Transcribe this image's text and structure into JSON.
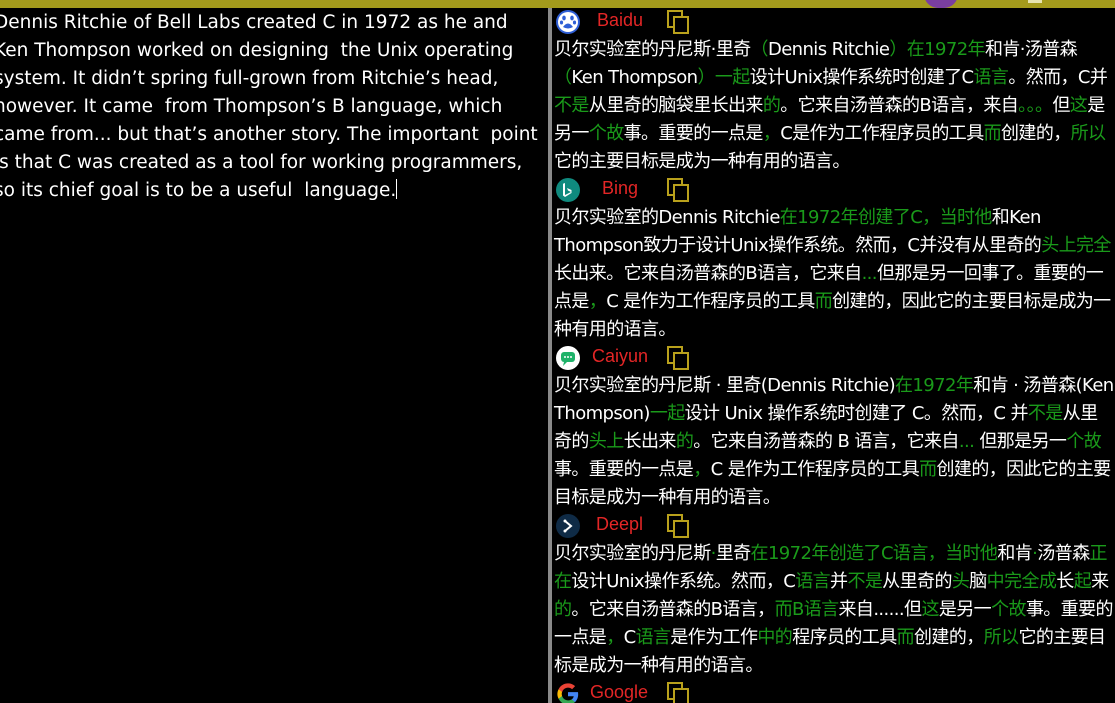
{
  "source": {
    "text": "Dennis Ritchie of Bell Labs created C in 1972 as he and Ken Thompson worked on designing  the Unix operating system. It didn’t spring full-grown from Ritchie’s head, however. It came  from Thompson’s B language, which came from... but that’s another story. The important  point is that C was created as a tool for working programmers, so its chief goal is to be a useful  language."
  },
  "engines": [
    {
      "name": "Baidu",
      "logo": "baidu-paw-icon",
      "segments": [
        [
          "贝尔实验室的丹尼斯·里奇",
          ""
        ],
        [
          "（",
          "g"
        ],
        [
          "Dennis Ritchie",
          ""
        ],
        [
          "）在1972年",
          "g"
        ],
        [
          "和肯·汤普森",
          ""
        ],
        [
          "（",
          "g"
        ],
        [
          "Ken Thompson",
          ""
        ],
        [
          "）一起",
          "g"
        ],
        [
          "设计Unix操作系统时创建了C",
          ""
        ],
        [
          "语言",
          "g"
        ],
        [
          "。然而，C并",
          ""
        ],
        [
          "不是",
          "g"
        ],
        [
          "从里奇的脑袋里长出来",
          ""
        ],
        [
          "的",
          "g"
        ],
        [
          "。它来自汤普森的B语言，来自",
          ""
        ],
        [
          "。。。",
          "g"
        ],
        [
          "但",
          ""
        ],
        [
          "这",
          "g"
        ],
        [
          "是另一",
          ""
        ],
        [
          "个故",
          "g"
        ],
        [
          "事。重要的一点是",
          ""
        ],
        [
          "，",
          "g"
        ],
        [
          "C是作为工作程序员的工具",
          ""
        ],
        [
          "而",
          "g"
        ],
        [
          "创建的，",
          ""
        ],
        [
          "所以",
          "g"
        ],
        [
          "它的主要目标是成为一种有用的语言。",
          ""
        ]
      ]
    },
    {
      "name": "Bing",
      "logo": "bing-icon",
      "segments": [
        [
          "贝尔实验室的Dennis Ritchie",
          ""
        ],
        [
          "在1972年创建了C，当时他",
          "g"
        ],
        [
          "和Ken Thompson致力于设计Unix操作系统。然而，C并没有从里奇的",
          ""
        ],
        [
          "头上完全",
          "g"
        ],
        [
          "长出来。它来自汤普森的B语言，它来自",
          ""
        ],
        [
          "...",
          "g"
        ],
        [
          "但那是另一回事了。重要的一点是",
          ""
        ],
        [
          "，",
          "g"
        ],
        [
          "C 是作为工作程序员的工具",
          ""
        ],
        [
          "而",
          "g"
        ],
        [
          "创建的，因此它的主要目标是成为一种有用的语言。",
          ""
        ]
      ]
    },
    {
      "name": "Caiyun",
      "logo": "caiyun-icon",
      "segments": [
        [
          "贝尔实验室的丹尼斯 · 里奇(Dennis Ritchie)",
          ""
        ],
        [
          "在1972年",
          "g"
        ],
        [
          "和肯 · 汤普森(Ken Thompson)",
          ""
        ],
        [
          "一起",
          "g"
        ],
        [
          "设计 Unix 操作系统时创建了 C。然而，C 并",
          ""
        ],
        [
          "不是",
          "g"
        ],
        [
          "从里奇的",
          ""
        ],
        [
          "头上",
          "g"
        ],
        [
          "长出来",
          ""
        ],
        [
          "的",
          "g"
        ],
        [
          "。它来自汤普森的 B 语言，它来自",
          ""
        ],
        [
          "...",
          "g"
        ],
        [
          " 但那是另一",
          ""
        ],
        [
          "个故",
          "g"
        ],
        [
          "事。重要的一点是",
          ""
        ],
        [
          "，",
          "g"
        ],
        [
          "C 是作为工作程序员的工具",
          ""
        ],
        [
          "而",
          "g"
        ],
        [
          "创建的，因此它的主要目标是成为一种有用的语言。",
          ""
        ]
      ]
    },
    {
      "name": "Deepl",
      "logo": "deepl-icon",
      "segments": [
        [
          "贝尔实验室的丹尼斯",
          ""
        ],
        [
          "·",
          "g"
        ],
        [
          "里奇",
          ""
        ],
        [
          "在1972年创造了C语言，当时他",
          "g"
        ],
        [
          "和肯",
          ""
        ],
        [
          "·",
          "g"
        ],
        [
          "汤普森",
          ""
        ],
        [
          "正在",
          "g"
        ],
        [
          "设计Unix操作系统。然而，C",
          ""
        ],
        [
          "语言",
          "g"
        ],
        [
          "并",
          ""
        ],
        [
          "不是",
          "g"
        ],
        [
          "从里奇的",
          ""
        ],
        [
          "头",
          "g"
        ],
        [
          "脑",
          ""
        ],
        [
          "中完全成",
          "g"
        ],
        [
          "长",
          ""
        ],
        [
          "起",
          "g"
        ],
        [
          "来",
          ""
        ],
        [
          "的",
          "g"
        ],
        [
          "。它来自汤普森的B语言，",
          ""
        ],
        [
          "而B语言",
          "g"
        ],
        [
          "来自......但",
          ""
        ],
        [
          "这",
          "g"
        ],
        [
          "是另一",
          ""
        ],
        [
          "个故",
          "g"
        ],
        [
          "事。重要的一点是",
          ""
        ],
        [
          "，",
          "g"
        ],
        [
          "C",
          ""
        ],
        [
          "语言",
          "g"
        ],
        [
          "是作为工作",
          ""
        ],
        [
          "中的",
          "g"
        ],
        [
          "程序员的工具",
          ""
        ],
        [
          "而",
          "g"
        ],
        [
          "创建的，",
          ""
        ],
        [
          "所以",
          "g"
        ],
        [
          "它的主要目标是成为一种有用的语言。",
          ""
        ]
      ]
    },
    {
      "name": "Google",
      "logo": "google-icon",
      "segments": []
    }
  ],
  "colors": {
    "engine_name": "#e32626",
    "highlight_green": "#1a9a1a",
    "copy_icon": "#b9a11c",
    "top_strip": "#a39a1c"
  }
}
